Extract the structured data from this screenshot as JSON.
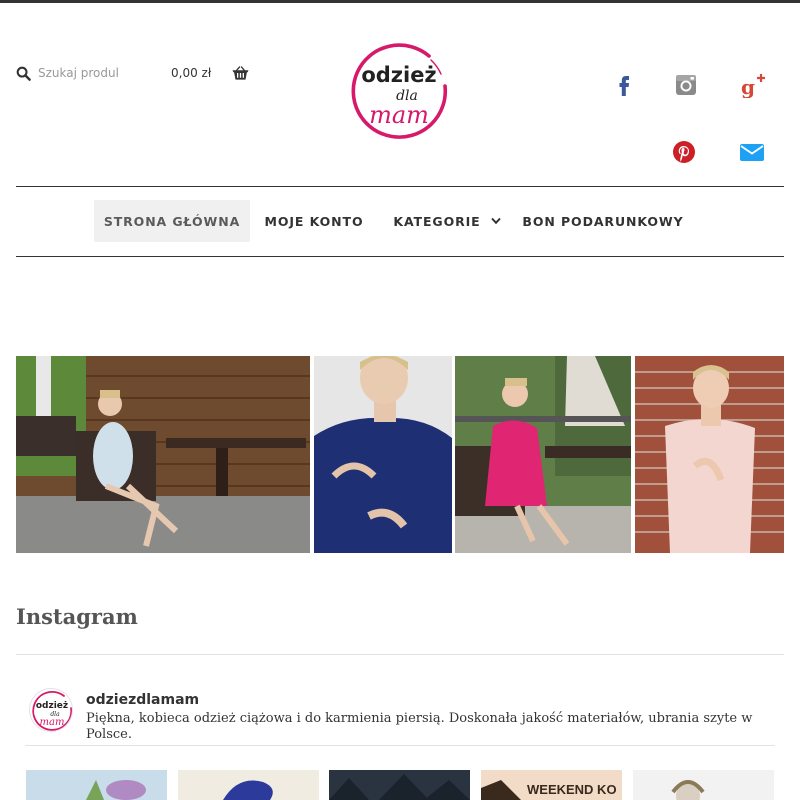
{
  "header": {
    "search": {
      "placeholder": "Szukaj produktów…"
    },
    "cart": {
      "amount": "0,00 zł"
    },
    "logo": {
      "alt": "odzież dla mam"
    }
  },
  "social": {
    "icons": [
      "facebook-icon",
      "instagram-icon",
      "google-plus-icon",
      "pinterest-icon",
      "email-icon"
    ],
    "colors": {
      "facebook": "#3b5998",
      "instagram": "#888888",
      "google_plus": "#d34836",
      "pinterest": "#cb2027",
      "email": "#1da1f2"
    }
  },
  "nav": {
    "items": [
      {
        "label": "STRONA GŁÓWNA",
        "active": true
      },
      {
        "label": "MOJE KONTO",
        "active": false
      },
      {
        "label": "KATEGORIE",
        "active": false,
        "has_dropdown": true
      },
      {
        "label": "BON PODARUNKOWY",
        "active": false
      }
    ]
  },
  "hero_photos": [
    {
      "name": "photo-light-blue-dress"
    },
    {
      "name": "photo-navy-dress"
    },
    {
      "name": "photo-pink-dress"
    },
    {
      "name": "photo-lace-dress"
    }
  ],
  "instagram": {
    "section_title": "Instagram",
    "username": "odziezdlamam",
    "bio": "Piękna, kobieca odzież ciążowa i do karmienia piersią. Doskonała jakość materiałów, ubrania szyte w Polsce.",
    "thumb_texts": [
      "WEEKEND KO"
    ]
  },
  "colors": {
    "brand": "#d6196b",
    "rule": "#333333",
    "nav_active_bg": "#f0f0f0"
  }
}
